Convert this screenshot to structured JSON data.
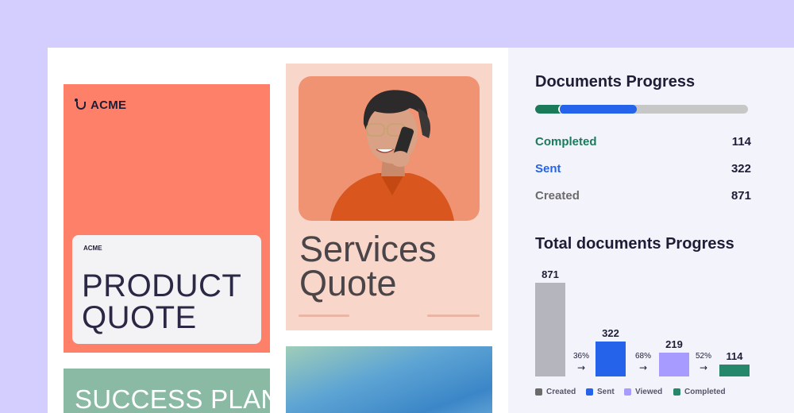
{
  "product_card": {
    "brand": "ACME",
    "inner_brand": "ACME",
    "title_line1": "PRODUCT",
    "title_line2": "QUOTE"
  },
  "services_card": {
    "title_line1": "Services",
    "title_line2": "Quote"
  },
  "success_card": {
    "title": "SUCCESS PLAN"
  },
  "documents_progress": {
    "title": "Documents Progress",
    "items": [
      {
        "label": "Completed",
        "value": "114",
        "color": "#1b7a5a"
      },
      {
        "label": "Sent",
        "value": "322",
        "color": "#2563eb"
      },
      {
        "label": "Created",
        "value": "871",
        "color": "#6b6b6b"
      }
    ],
    "bar_track_color": "#c7c7c7"
  },
  "total_progress": {
    "title": "Total documents Progress",
    "conversions": [
      "36%",
      "68%",
      "52%"
    ],
    "legend": [
      "Created",
      "Sent",
      "Viewed",
      "Completed"
    ]
  },
  "chart_data": {
    "type": "bar",
    "categories": [
      "Created",
      "Sent",
      "Viewed",
      "Completed"
    ],
    "values": [
      871,
      322,
      219,
      114
    ],
    "data_labels": [
      "871",
      "322",
      "219",
      "114"
    ],
    "colors": [
      "#b5b5bd",
      "#2563eb",
      "#a79bff",
      "#26876a"
    ]
  }
}
